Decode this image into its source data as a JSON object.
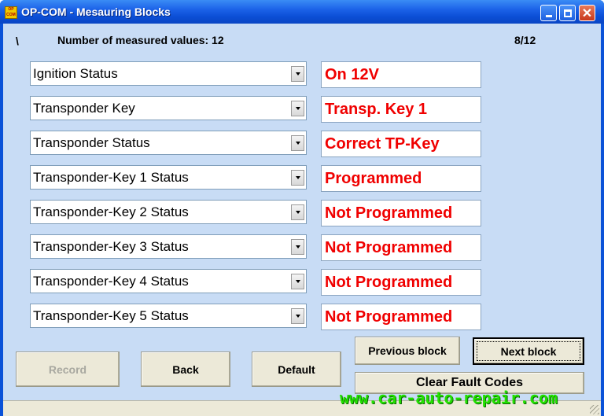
{
  "window": {
    "title": "OP-COM - Mesauring Blocks",
    "icon_label": "OP COM",
    "close_glyph": "✕"
  },
  "header": {
    "indicator": "\\",
    "measured_values": "Number of measured values: 12",
    "page": "8/12"
  },
  "rows": [
    {
      "label": "Ignition Status",
      "value": "On  12V"
    },
    {
      "label": "Transponder Key",
      "value": "Transp. Key 1"
    },
    {
      "label": "Transponder Status",
      "value": "Correct TP-Key"
    },
    {
      "label": "Transponder-Key 1 Status",
      "value": "Programmed"
    },
    {
      "label": "Transponder-Key 2 Status",
      "value": "Not Programmed"
    },
    {
      "label": "Transponder-Key 3 Status",
      "value": "Not Programmed"
    },
    {
      "label": "Transponder-Key 4 Status",
      "value": "Not Programmed"
    },
    {
      "label": "Transponder-Key 5 Status",
      "value": "Not Programmed"
    }
  ],
  "buttons": {
    "record": "Record",
    "back": "Back",
    "default": "Default",
    "previous_block": "Previous block",
    "next_block": "Next block",
    "clear_fault_codes": "Clear Fault Codes"
  },
  "watermark": "www.car-auto-repair.com",
  "colors": {
    "value_text": "#f00000",
    "client_bg": "#c8dcf5",
    "title_bar": "#0b4fd6",
    "watermark": "#22e000"
  }
}
